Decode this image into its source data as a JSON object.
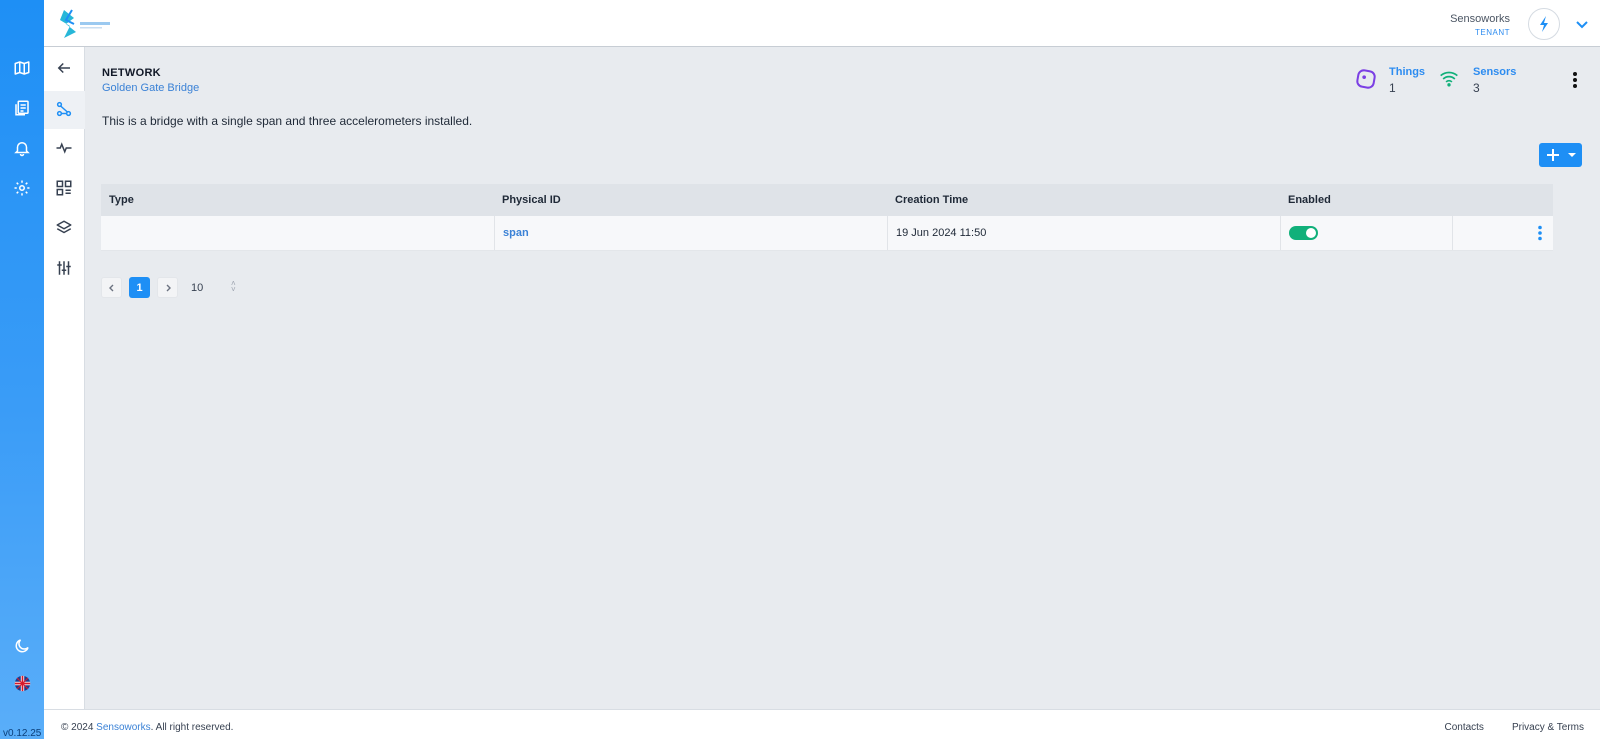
{
  "rail": {
    "icons": [
      "map-icon",
      "documents-icon",
      "bell-icon",
      "gear-icon",
      "moon-icon",
      "uk-flag-icon"
    ],
    "version": "v0.12.25"
  },
  "header": {
    "logo": "sensoworks-logo",
    "tenant_name": "Sensoworks",
    "tenant_role": "TENANT"
  },
  "subnav": {
    "icons": [
      "back-arrow-icon",
      "network-icon",
      "activity-icon",
      "dashboard-icon",
      "layers-icon",
      "sliders-icon"
    ]
  },
  "page": {
    "title": "NETWORK",
    "subtitle": "Golden Gate Bridge",
    "description": "This is a bridge with a single span and three accelerometers installed."
  },
  "stats": {
    "things_label": "Things",
    "things_value": "1",
    "sensors_label": "Sensors",
    "sensors_value": "3"
  },
  "table": {
    "columns": [
      "Type",
      "Physical ID",
      "Creation Time",
      "Enabled"
    ],
    "rows": [
      {
        "type": "",
        "physical_id": "span",
        "creation_time": "19 Jun 2024 11:50",
        "enabled": true
      }
    ]
  },
  "pagination": {
    "current_page": "1",
    "page_size": "10"
  },
  "footer": {
    "copyright_prefix": "© 2024 ",
    "brand": "Sensoworks",
    "copyright_suffix": ". All right reserved.",
    "contacts": "Contacts",
    "privacy": "Privacy & Terms"
  },
  "colors": {
    "accent": "#1e8ff5",
    "link": "#3b82d6",
    "toggle_on": "#11b07a",
    "things_icon": "#7b3fe4",
    "sensors_icon": "#11b07a"
  }
}
